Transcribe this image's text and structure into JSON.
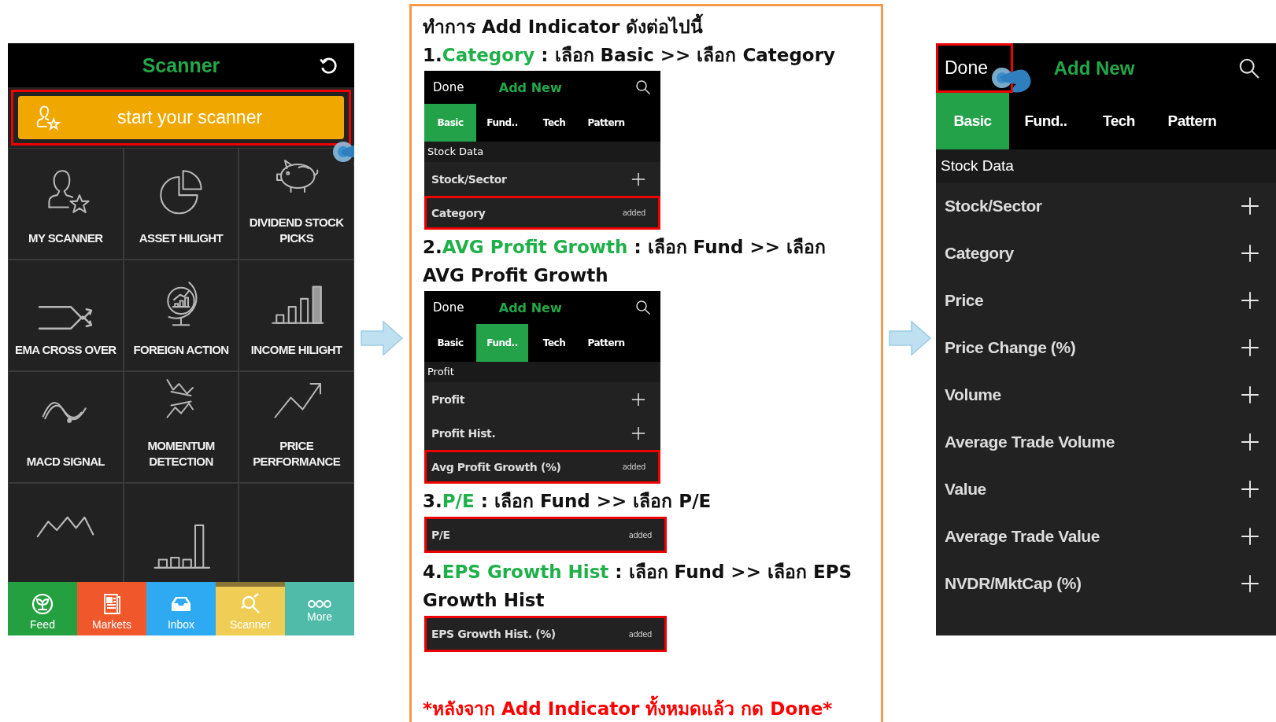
{
  "scanner_screen": {
    "title": "Scanner",
    "start_button": {
      "label": "start your scanner",
      "highlighted": true
    },
    "tiles": [
      {
        "label": "MY SCANNER"
      },
      {
        "label": "ASSET HILIGHT"
      },
      {
        "label": "DIVIDEND STOCK PICKS"
      },
      {
        "label": "EMA CROSS OVER"
      },
      {
        "label": "FOREIGN ACTION"
      },
      {
        "label": "INCOME HILIGHT"
      },
      {
        "label": "MACD SIGNAL"
      },
      {
        "label": "MOMENTUM DETECTION"
      },
      {
        "label": "PRICE PERFORMANCE"
      },
      {
        "kind": "icon"
      },
      {
        "kind": "icon"
      },
      {
        "kind": "blank"
      }
    ],
    "tab_bar": [
      {
        "label": "Feed",
        "color": "#25a040",
        "selected": false
      },
      {
        "label": "Markets",
        "color": "#f0582c",
        "selected": false
      },
      {
        "label": "Inbox",
        "color": "#2eaaf2",
        "selected": false
      },
      {
        "label": "Scanner",
        "color": "#f0cd55",
        "selected": true
      },
      {
        "label": "More",
        "color": "#50bba8",
        "selected": false
      }
    ]
  },
  "instructions": {
    "heading": "ทำการ Add Indicator ดังต่อไปนี้",
    "steps": [
      {
        "number": "1.",
        "name": "Category",
        "text": " : เลือก Basic >> เลือก Category",
        "kind": "screen",
        "screen": {
          "done": {
            "label": "Done",
            "highlighted": false
          },
          "title": "Add New",
          "tabs": [
            {
              "label": "Basic",
              "selected": true
            },
            {
              "label": "Fund..",
              "selected": false
            },
            {
              "label": "Tech",
              "selected": false
            },
            {
              "label": "Pattern",
              "selected": false
            }
          ],
          "section": "Stock Data",
          "rows": [
            {
              "label": "Stock/Sector",
              "highlighted": false
            },
            {
              "label": "Category",
              "status": "added",
              "highlighted": true
            }
          ]
        }
      },
      {
        "number": "2.",
        "name": "AVG Profit Growth",
        "text": " : เลือก Fund >> เลือก AVG Profit Growth",
        "kind": "screen",
        "screen": {
          "done": {
            "label": "Done",
            "highlighted": false
          },
          "title": "Add New",
          "tabs": [
            {
              "label": "Basic",
              "selected": false
            },
            {
              "label": "Fund..",
              "selected": true
            },
            {
              "label": "Tech",
              "selected": false
            },
            {
              "label": "Pattern",
              "selected": false
            }
          ],
          "section": "Profit",
          "rows": [
            {
              "label": "Profit",
              "highlighted": false
            },
            {
              "label": "Profit Hist.",
              "highlighted": false
            },
            {
              "label": "Avg Profit Growth (%)",
              "status": "added",
              "highlighted": true
            }
          ]
        }
      },
      {
        "number": "3.",
        "name": "P/E",
        "text": " : เลือก Fund >> เลือก P/E",
        "kind": "row",
        "rows": [
          {
            "label": "P/E",
            "status": "added",
            "highlighted": true
          }
        ]
      },
      {
        "number": "4.",
        "name": "EPS Growth Hist",
        "text": " : เลือก Fund >> เลือก EPS Growth Hist",
        "kind": "row",
        "rows": [
          {
            "label": "EPS Growth Hist. (%)",
            "status": "added",
            "highlighted": true
          }
        ]
      }
    ],
    "footer": "*หลังจาก Add Indicator ทั้งหมดแล้ว กด Done*"
  },
  "result_screen": {
    "done": {
      "label": "Done",
      "highlighted": true
    },
    "title": "Add New",
    "tabs": [
      {
        "label": "Basic",
        "selected": true
      },
      {
        "label": "Fund..",
        "selected": false
      },
      {
        "label": "Tech",
        "selected": false
      },
      {
        "label": "Pattern",
        "selected": false
      }
    ],
    "section": "Stock Data",
    "rows": [
      {
        "label": "Stock/Sector",
        "highlighted": false
      },
      {
        "label": "Category",
        "highlighted": false
      },
      {
        "label": "Price",
        "highlighted": false
      },
      {
        "label": "Price Change (%)",
        "highlighted": false
      },
      {
        "label": "Volume",
        "highlighted": false
      },
      {
        "label": "Average Trade Volume",
        "highlighted": false
      },
      {
        "label": "Value",
        "highlighted": false
      },
      {
        "label": "Average Trade Value",
        "highlighted": false
      },
      {
        "label": "NVDR/MktCap (%)",
        "highlighted": false
      }
    ]
  }
}
